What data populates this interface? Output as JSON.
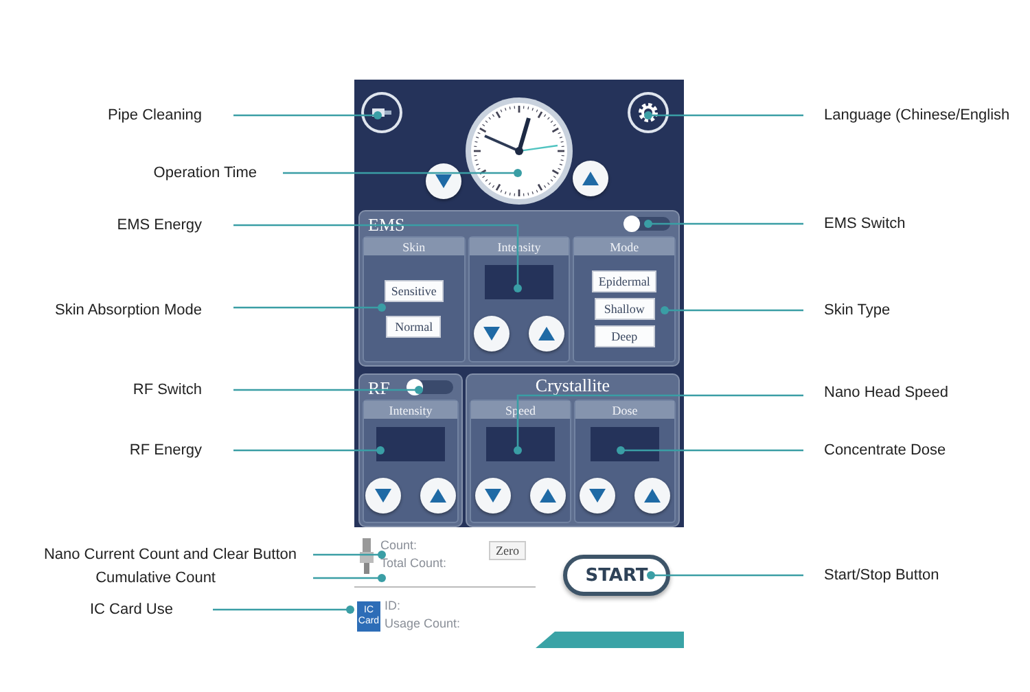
{
  "left_callouts": [
    {
      "label": "Pipe Cleaning"
    },
    {
      "label": "Operation Time"
    },
    {
      "label": "EMS Energy"
    },
    {
      "label": "Skin Absorption Mode"
    },
    {
      "label": "RF Switch"
    },
    {
      "label": "RF Energy"
    },
    {
      "label": "Nano Current Count and Clear Button"
    },
    {
      "label": "Cumulative Count"
    },
    {
      "label": "IC Card Use"
    }
  ],
  "right_callouts": [
    {
      "label": "Language (Chinese/English"
    },
    {
      "label": "EMS Switch"
    },
    {
      "label": "Skin Type"
    },
    {
      "label": "Nano Head Speed"
    },
    {
      "label": "Concentrate Dose"
    },
    {
      "label": "Start/Stop Button"
    }
  ],
  "device": {
    "ems": {
      "title": "EMS",
      "switch": {
        "on": false
      },
      "columns": [
        {
          "title": "Skin",
          "kind": "options",
          "options": [
            "Sensitive",
            "Normal"
          ]
        },
        {
          "title": "Intensity",
          "kind": "display"
        },
        {
          "title": "Mode",
          "kind": "options",
          "options": [
            "Epidermal",
            "Shallow",
            "Deep"
          ]
        }
      ]
    },
    "rf": {
      "title": "RF",
      "switch": {
        "on": false
      },
      "columns": [
        {
          "title": "Intensity",
          "kind": "display"
        }
      ]
    },
    "crystallite": {
      "title": "Crystallite",
      "columns": [
        {
          "title": "Speed",
          "kind": "display"
        },
        {
          "title": "Dose",
          "kind": "display"
        }
      ]
    },
    "counter": {
      "count_label": "Count:",
      "total_label": "Total Count:",
      "zero_button": "Zero"
    },
    "card": {
      "icon_lines": [
        "IC",
        "Card"
      ],
      "id_label": "ID:",
      "usage_label": "Usage Count:"
    },
    "start_button": "START"
  }
}
